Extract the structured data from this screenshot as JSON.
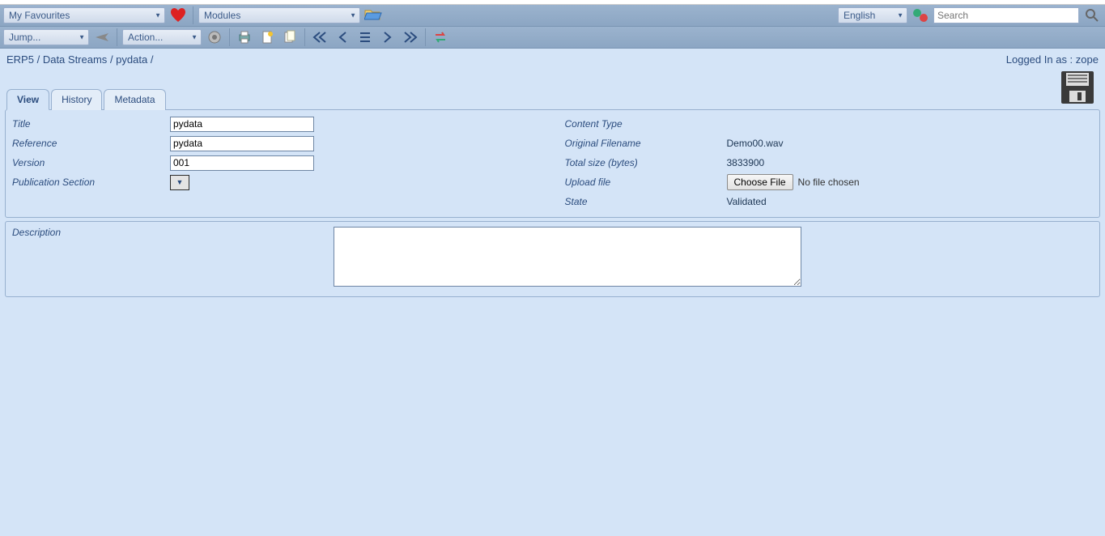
{
  "topbar": {
    "favourites_label": "My Favourites",
    "modules_label": "Modules",
    "language_label": "English",
    "search_placeholder": "Search"
  },
  "actionbar": {
    "jump_label": "Jump...",
    "action_label": "Action..."
  },
  "breadcrumb": {
    "root": "ERP5",
    "module": "Data Streams",
    "item": "pydata"
  },
  "user": {
    "prefix": "Logged In as :",
    "name": "zope"
  },
  "tabs": {
    "view": "View",
    "history": "History",
    "metadata": "Metadata"
  },
  "form": {
    "left": {
      "title_label": "Title",
      "title_value": "pydata",
      "reference_label": "Reference",
      "reference_value": "pydata",
      "version_label": "Version",
      "version_value": "001",
      "pubsection_label": "Publication Section"
    },
    "right": {
      "content_type_label": "Content Type",
      "filename_label": "Original Filename",
      "filename_value": "Demo00.wav",
      "size_label": "Total size (bytes)",
      "size_value": "3833900",
      "upload_label": "Upload file",
      "choose_file_label": "Choose File",
      "no_file_label": "No file chosen",
      "state_label": "State",
      "state_value": "Validated"
    },
    "description_label": "Description"
  }
}
